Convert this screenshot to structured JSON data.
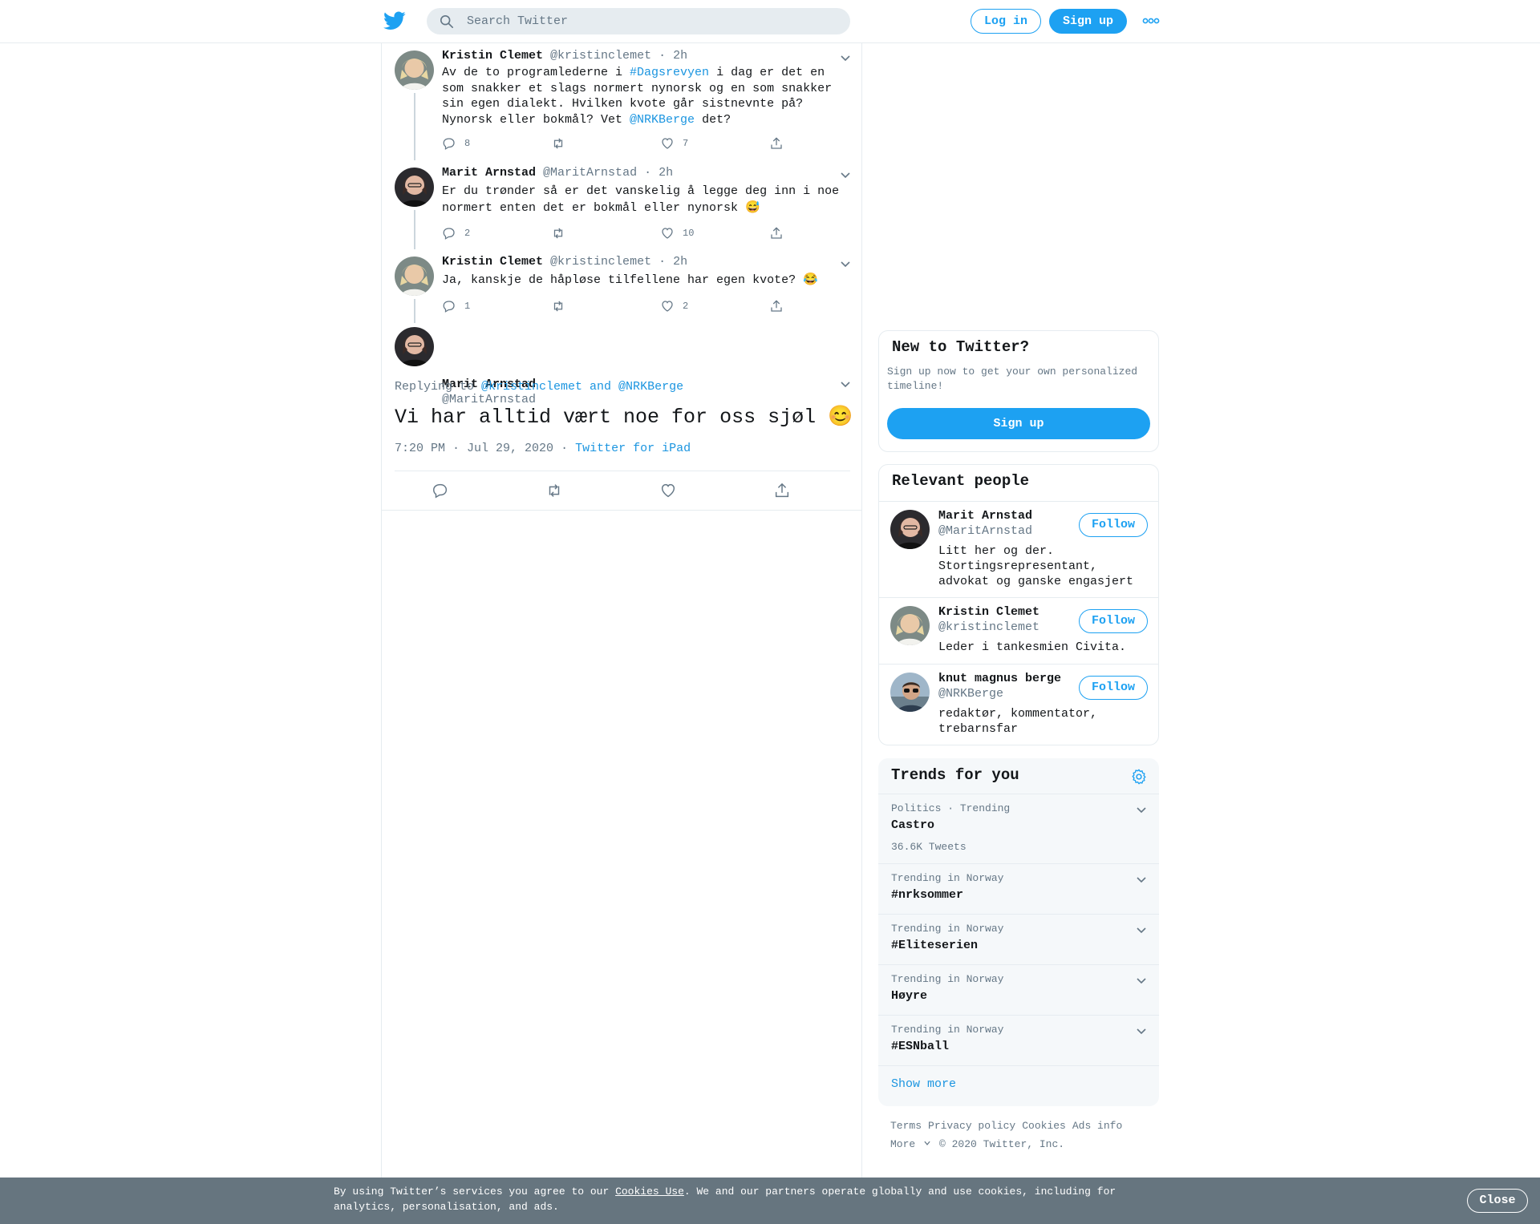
{
  "header": {
    "search_placeholder": "Search Twitter",
    "login_label": "Log in",
    "signup_label": "Sign up"
  },
  "thread": [
    {
      "name": "Kristin Clemet",
      "handle": "@kristinclemet",
      "time": "· 2h",
      "text_parts": [
        "Av de to programlederne i ",
        "#Dagsrevyen",
        " i dag er det en som snakker et slags normert nynorsk og en som snakker sin egen dialekt. Hvilken kvote går sistnevnte på? Nynorsk eller bokmål? Vet ",
        "@NRKBerge",
        " det?"
      ],
      "replies": "8",
      "retweets": "",
      "likes": "7"
    },
    {
      "name": "Marit Arnstad",
      "handle": "@MaritArnstad",
      "time": "· 2h",
      "text": "Er du trønder så er det vanskelig å legge deg inn i noe normert enten det er bokmål eller nynorsk 😅",
      "replies": "2",
      "retweets": "",
      "likes": "10"
    },
    {
      "name": "Kristin Clemet",
      "handle": "@kristinclemet",
      "time": "· 2h",
      "text": "Ja, kanskje de håpløse tilfellene har egen kvote? 😂",
      "replies": "1",
      "retweets": "",
      "likes": "2"
    }
  ],
  "focus": {
    "name": "Marit Arnstad",
    "handle": "@MaritArnstad",
    "replying_prefix": "Replying to ",
    "replying_to": "@kristinclemet and @NRKBerge",
    "text": "Vi har alltid vært noe for oss sjøl 😊",
    "datetime": "7:20 PM · Jul 29, 2020",
    "separator": "·",
    "source": "Twitter for iPad"
  },
  "new_to_twitter": {
    "title": "New to Twitter?",
    "description": "Sign up now to get your own personalized timeline!",
    "signup_label": "Sign up"
  },
  "relevant_people": {
    "title": "Relevant people",
    "follow_label": "Follow",
    "people": [
      {
        "name": "Marit Arnstad",
        "handle": "@MaritArnstad",
        "bio": "Litt her og der. Stortingsrepresentant, advokat og ganske engasjert"
      },
      {
        "name": "Kristin Clemet",
        "handle": "@kristinclemet",
        "bio": "Leder i tankesmien Civita."
      },
      {
        "name": "knut magnus berge",
        "handle": "@NRKBerge",
        "bio": "redaktør, kommentator, trebarnsfar"
      }
    ]
  },
  "trends": {
    "title": "Trends for you",
    "items": [
      {
        "meta": "Politics · Trending",
        "name": "Castro",
        "count": "36.6K Tweets"
      },
      {
        "meta": "Trending in Norway",
        "name": "#nrksommer",
        "count": ""
      },
      {
        "meta": "Trending in Norway",
        "name": "#Eliteserien",
        "count": ""
      },
      {
        "meta": "Trending in Norway",
        "name": "Høyre",
        "count": ""
      },
      {
        "meta": "Trending in Norway",
        "name": "#ESNball",
        "count": ""
      }
    ],
    "show_more": "Show more"
  },
  "footer": {
    "links": [
      "Terms",
      "Privacy policy",
      "Cookies",
      "Ads info"
    ],
    "more": "More",
    "copyright": "© 2020 Twitter, Inc."
  },
  "cookie_bar": {
    "text_before": "By using Twitter’s services you agree to our ",
    "link": "Cookies Use",
    "text_after": ". We and our partners operate globally and use cookies, including for analytics, personalisation, and ads.",
    "close_label": "Close"
  },
  "colors": {
    "accent": "#1da1f2",
    "link": "#1b95e0",
    "muted": "#657786",
    "cookie_bar": "#66757f"
  }
}
